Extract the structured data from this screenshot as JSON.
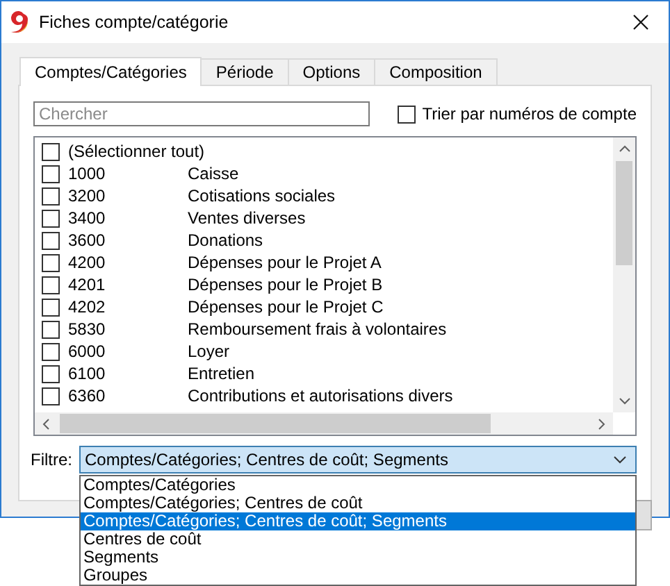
{
  "window": {
    "title": "Fiches compte/catégorie"
  },
  "tabs": [
    {
      "label": "Comptes/Catégories",
      "selected": true
    },
    {
      "label": "Période",
      "selected": false
    },
    {
      "label": "Options",
      "selected": false
    },
    {
      "label": "Composition",
      "selected": false
    }
  ],
  "search": {
    "placeholder": "Chercher"
  },
  "sort_checkbox": {
    "label": "Trier par numéros de compte",
    "checked": false
  },
  "accounts": [
    {
      "kind": "select_all",
      "label": "(Sélectionner tout)",
      "checked": false
    },
    {
      "kind": "account",
      "number": "1000",
      "name": "Caisse",
      "checked": false
    },
    {
      "kind": "account",
      "number": "3200",
      "name": "Cotisations sociales",
      "checked": false
    },
    {
      "kind": "account",
      "number": "3400",
      "name": "Ventes diverses",
      "checked": false
    },
    {
      "kind": "account",
      "number": "3600",
      "name": "Donations",
      "checked": false
    },
    {
      "kind": "account",
      "number": "4200",
      "name": "Dépenses pour le Projet A",
      "checked": false
    },
    {
      "kind": "account",
      "number": "4201",
      "name": "Dépenses pour le Projet B",
      "checked": false
    },
    {
      "kind": "account",
      "number": "4202",
      "name": "Dépenses pour le Projet C",
      "checked": false
    },
    {
      "kind": "account",
      "number": "5830",
      "name": "Remboursement frais à volontaires",
      "checked": false
    },
    {
      "kind": "account",
      "number": "6000",
      "name": "Loyer",
      "checked": false
    },
    {
      "kind": "account",
      "number": "6100",
      "name": "Entretien",
      "checked": false
    },
    {
      "kind": "account",
      "number": "6360",
      "name": "Contributions et autorisations divers",
      "checked": false
    }
  ],
  "filter": {
    "label": "Filtre:",
    "value": "Comptes/Catégories; Centres de coût; Segments",
    "expanded": true,
    "options": [
      {
        "label": "Comptes/Catégories",
        "selected": false
      },
      {
        "label": "Comptes/Catégories; Centres de coût",
        "selected": false
      },
      {
        "label": "Comptes/Catégories; Centres de coût; Segments",
        "selected": true
      },
      {
        "label": "Centres de coût",
        "selected": false
      },
      {
        "label": "Segments",
        "selected": false
      },
      {
        "label": "Groupes",
        "selected": false
      }
    ]
  }
}
